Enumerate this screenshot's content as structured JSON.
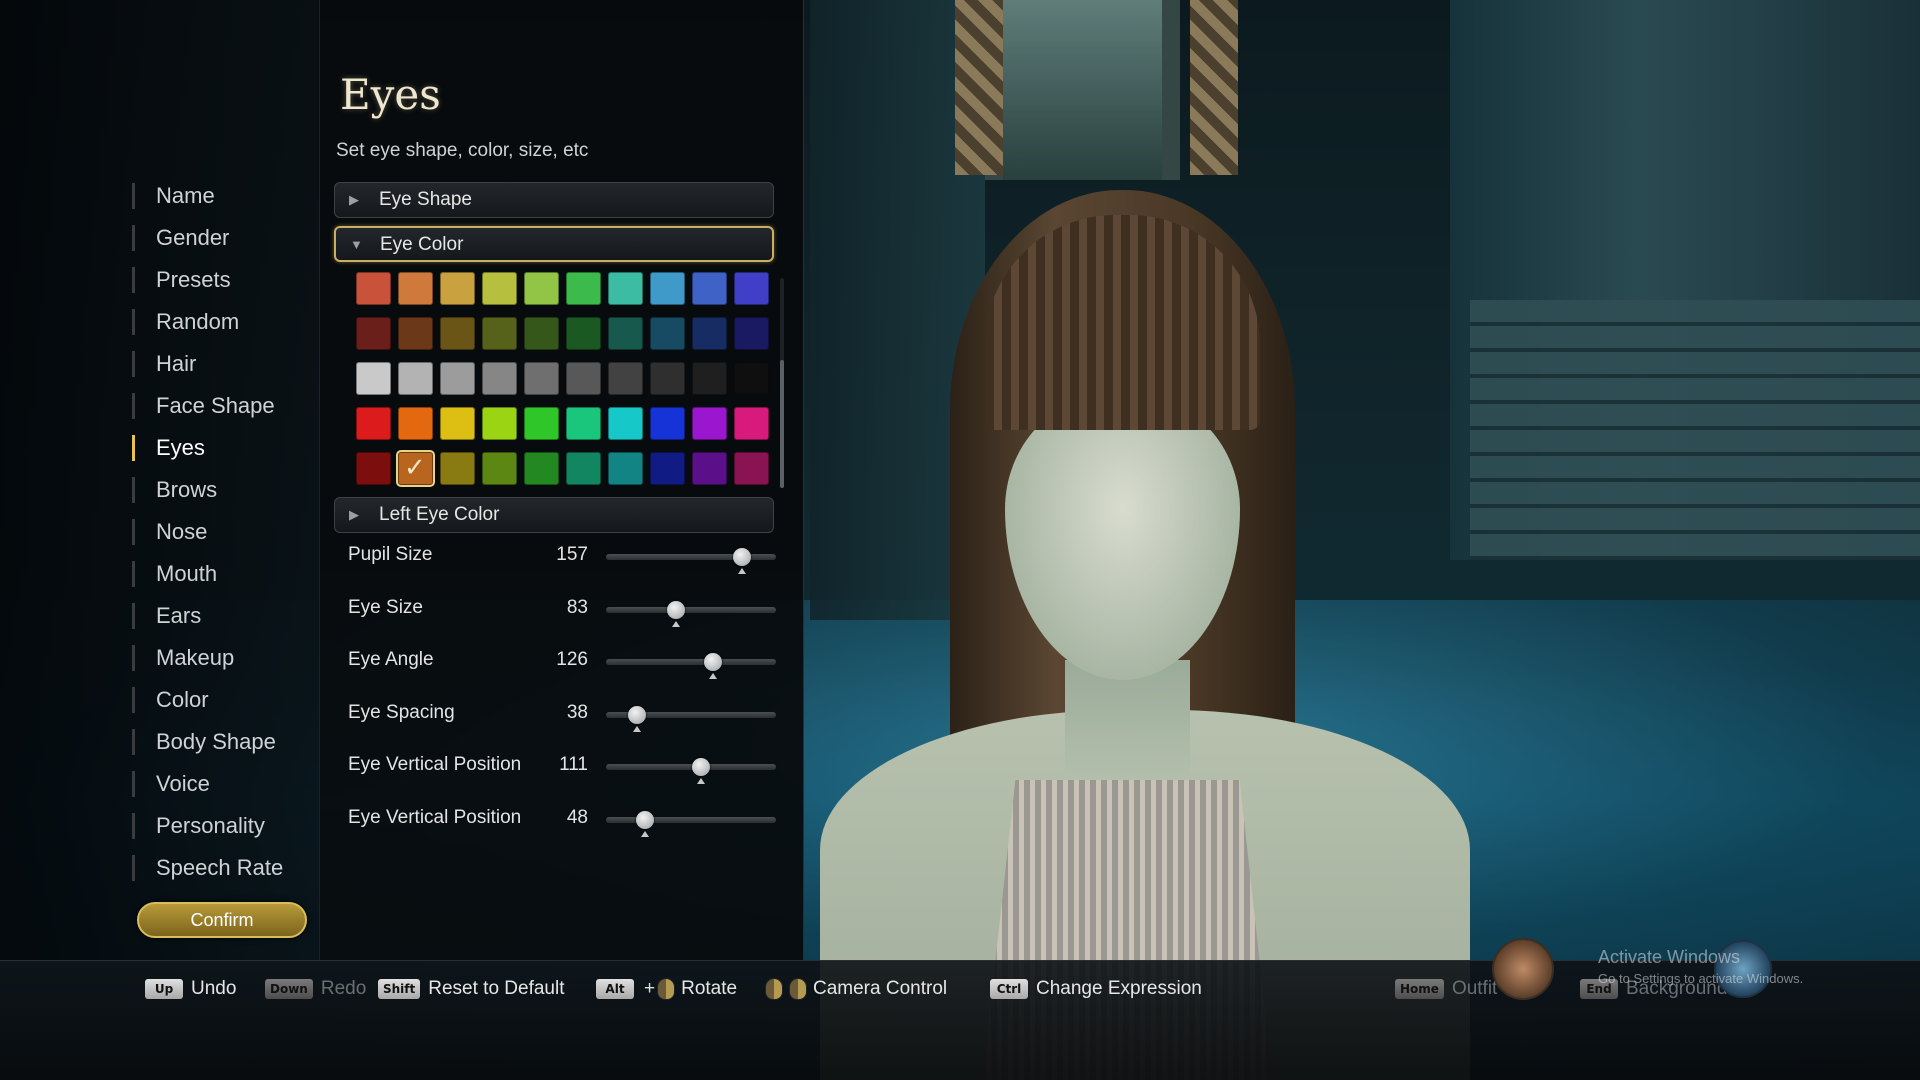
{
  "nav": {
    "items": [
      "Name",
      "Gender",
      "Presets",
      "Random",
      "Hair",
      "Face Shape",
      "Eyes",
      "Brows",
      "Nose",
      "Mouth",
      "Ears",
      "Makeup",
      "Color",
      "Body Shape",
      "Voice",
      "Personality",
      "Speech Rate"
    ],
    "active_index": 6,
    "confirm_label": "Confirm"
  },
  "panel": {
    "title": "Eyes",
    "subtitle": "Set eye shape, color, size, etc",
    "sections": [
      {
        "label": "Eye Shape",
        "open": false
      },
      {
        "label": "Eye Color",
        "open": true
      },
      {
        "label": "Left Eye Color",
        "open": false
      }
    ],
    "eye_color_swatches": [
      [
        "#c8523a",
        "#cf7a3c",
        "#c9a23f",
        "#b6c03e",
        "#92c445",
        "#3cbb4c",
        "#3cbca2",
        "#3f9ac9",
        "#3f62c7",
        "#3f3fc8"
      ],
      [
        "#6a1f1a",
        "#6b3818",
        "#6b5516",
        "#56621a",
        "#35581a",
        "#1a5a22",
        "#17594d",
        "#174a63",
        "#172c63",
        "#1a1a62"
      ],
      [
        "#c9c9c9",
        "#b3b3b3",
        "#9c9c9c",
        "#868686",
        "#6f6f6f",
        "#585858",
        "#424242",
        "#2f2f2f",
        "#1f1f1f",
        "#0f0f0f"
      ],
      [
        "#dc1c1c",
        "#e3680f",
        "#ddbe13",
        "#9bd413",
        "#2fc62a",
        "#19c67b",
        "#16c8c8",
        "#1533d6",
        "#9a16cf",
        "#d71a7c"
      ],
      [
        "#7c0e0e",
        "#b8651f",
        "#8a7a12",
        "#5b8712",
        "#238822",
        "#118660",
        "#128484",
        "#101c84",
        "#5b108a",
        "#8a1453"
      ]
    ],
    "selected_swatch": {
      "row": 4,
      "col": 1
    },
    "sliders": [
      {
        "label": "Pupil Size",
        "value": "157",
        "fraction": 0.8
      },
      {
        "label": "Eye Size",
        "value": "83",
        "fraction": 0.41
      },
      {
        "label": "Eye Angle",
        "value": "126",
        "fraction": 0.63
      },
      {
        "label": "Eye Spacing",
        "value": "38",
        "fraction": 0.18
      },
      {
        "label": "Eye Vertical Position",
        "value": "111",
        "fraction": 0.56
      },
      {
        "label": "Eye Vertical Position",
        "value": "48",
        "fraction": 0.23
      }
    ]
  },
  "hints": [
    {
      "keys": [
        "Up"
      ],
      "label": "Undo",
      "dim": false
    },
    {
      "keys": [
        "Down"
      ],
      "label": "Redo",
      "dim": true
    },
    {
      "keys": [
        "Shift"
      ],
      "label": "Reset to Default",
      "dim": false
    },
    {
      "keys": [
        "Alt",
        "+",
        "mouse"
      ],
      "label": "Rotate",
      "dim": false
    },
    {
      "keys": [
        "mouse",
        "mouse"
      ],
      "label": "Camera Control",
      "dim": false
    },
    {
      "keys": [
        "Ctrl"
      ],
      "label": "Change Expression",
      "dim": false
    },
    {
      "keys": [
        "Home"
      ],
      "label": "Outfit",
      "dim": true
    },
    {
      "keys": [
        "End"
      ],
      "label": "Background",
      "dim": true
    }
  ],
  "watermark": {
    "title": "Activate Windows",
    "subtitle": "Go to Settings to activate Windows."
  },
  "icons": {
    "mouse": "mouse-icon",
    "outfit": "outfit-icon",
    "background": "background-icon"
  }
}
